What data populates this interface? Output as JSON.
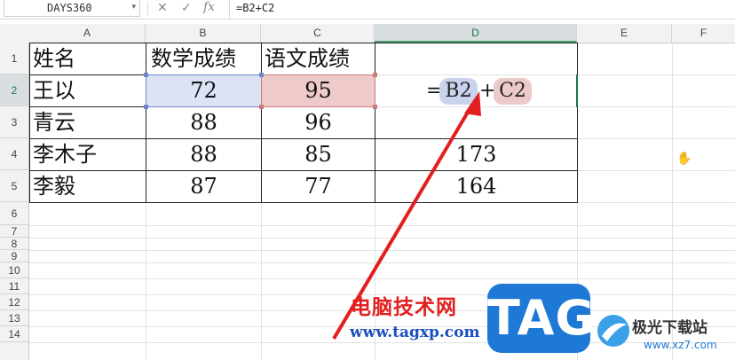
{
  "formula_bar": {
    "name_box": "DAYS360",
    "formula": "=B2+C2",
    "cancel_glyph": "✕",
    "confirm_glyph": "✓",
    "fx_glyph": "fx"
  },
  "columns": [
    "A",
    "B",
    "C",
    "D",
    "E",
    "F"
  ],
  "rows": [
    "1",
    "2",
    "3",
    "4",
    "5",
    "6",
    "7",
    "8",
    "9",
    "10",
    "11",
    "12",
    "13",
    "14"
  ],
  "table": {
    "header": [
      "姓名",
      "数学成绩",
      "语文成绩"
    ],
    "data": [
      {
        "name": "王以",
        "math": "72",
        "chinese": "95",
        "total": ""
      },
      {
        "name": "青云",
        "math": "88",
        "chinese": "96",
        "total": ""
      },
      {
        "name": "李木子",
        "math": "88",
        "chinese": "85",
        "total": "173"
      },
      {
        "name": "李毅",
        "math": "87",
        "chinese": "77",
        "total": "164"
      }
    ]
  },
  "edit_formula": {
    "eq": "=",
    "ref1": "B2",
    "op": "+",
    "ref2": "C2"
  },
  "colors": {
    "accent": "#217346",
    "ref1_fill": "#dce3f4",
    "ref2_fill": "#eecaca",
    "arrow": "#e21f1f"
  },
  "watermark": {
    "site_name": "电脑技术网",
    "url": "www.tagxp.com",
    "tag": "TAG",
    "logo_text": "极光下载站",
    "logo_url": "www.xz7.com"
  }
}
